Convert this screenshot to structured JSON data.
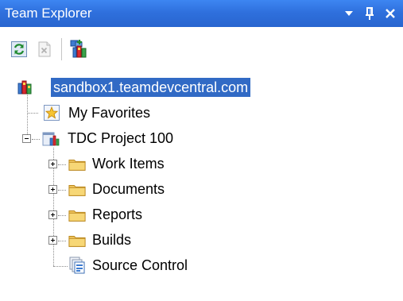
{
  "window": {
    "title": "Team Explorer",
    "accent": "#2f70dd",
    "selection_color": "#316ac5"
  },
  "titlebar_buttons": [
    {
      "icon": "dropdown-arrow-icon"
    },
    {
      "icon": "pin-icon"
    },
    {
      "icon": "close-icon"
    }
  ],
  "toolbar": [
    {
      "icon": "refresh-icon",
      "enabled": true
    },
    {
      "icon": "delete-icon",
      "enabled": false
    },
    {
      "icon": "connect-server-icon",
      "enabled": true
    }
  ],
  "tree": {
    "server": {
      "label": "sandbox1.teamdevcentral.com",
      "icon": "team-server-icon",
      "selected": true
    },
    "favorites": {
      "label": "My Favorites",
      "icon": "star-icon"
    },
    "project": {
      "label": "TDC Project 100",
      "icon": "team-project-icon",
      "expanded": true
    },
    "children": [
      {
        "label": "Work Items",
        "icon": "folder-icon",
        "expandable": true
      },
      {
        "label": "Documents",
        "icon": "folder-icon",
        "expandable": true
      },
      {
        "label": "Reports",
        "icon": "folder-icon",
        "expandable": true
      },
      {
        "label": "Builds",
        "icon": "folder-icon",
        "expandable": true
      },
      {
        "label": "Source Control",
        "icon": "source-control-icon",
        "expandable": false
      }
    ]
  }
}
